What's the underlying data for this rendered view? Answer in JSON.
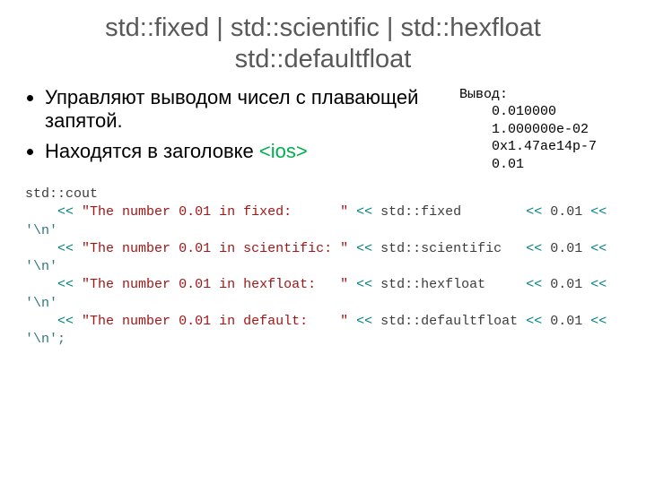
{
  "title_line1": "std::fixed | std::scientific | std::hexfloat",
  "title_line2": "std::defaultfloat",
  "bullets": {
    "b0": "Управляют выводом чисел с плавающей запятой.",
    "b1_a": "Находятся в заголовке ",
    "b1_tag": "<ios>"
  },
  "output": {
    "header": "Вывод:",
    "lines": {
      "l0": "    0.010000",
      "l1": "    1.000000e-02",
      "l2": "    0x1.47ae14p-7",
      "l3": "    0.01"
    }
  },
  "code": {
    "cout": "std::cout",
    "op": "<<",
    "num": "0.01",
    "nl": "'\\n'",
    "semnl": "'\\n';",
    "s_fixed": "\"The number 0.01 in fixed:      \"",
    "s_scientific": "\"The number 0.01 in scientific: \"",
    "s_hexfloat": "\"The number 0.01 in hexfloat:   \"",
    "s_default": "\"The number 0.01 in default:    \"",
    "m_fixed": "std::fixed       ",
    "m_scientific": "std::scientific  ",
    "m_hexfloat": "std::hexfloat    ",
    "m_default": "std::defaultfloat"
  }
}
